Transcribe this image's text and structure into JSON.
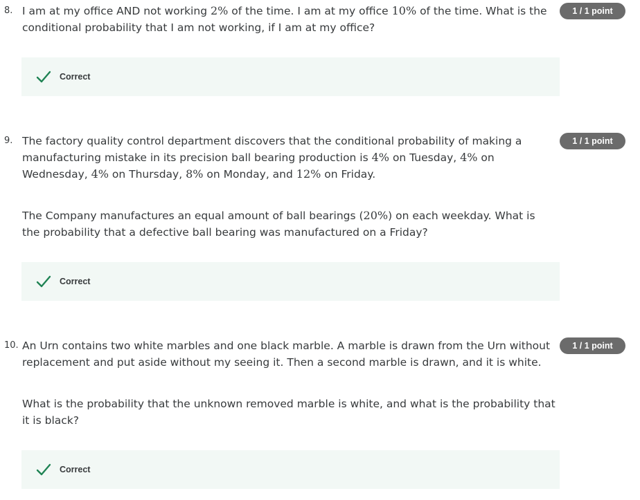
{
  "questions": [
    {
      "number": "8.",
      "points": "1 / 1 point",
      "status": "Correct",
      "paragraphs": [
        [
          {
            "t": "I am at my office AND not working "
          },
          {
            "t": "2%",
            "math": true
          },
          {
            "t": " of the time.  I am at my office "
          },
          {
            "t": "10%",
            "math": true
          },
          {
            "t": " of the time. What is the conditional probability that I am not working, if I am at my office?"
          }
        ]
      ]
    },
    {
      "number": "9.",
      "points": "1 / 1 point",
      "status": "Correct",
      "paragraphs": [
        [
          {
            "t": "The factory quality control department discovers that the conditional probability of making a manufacturing mistake in its precision ball bearing production is "
          },
          {
            "t": "4%",
            "math": true
          },
          {
            "t": " on Tuesday, "
          },
          {
            "t": "4%",
            "math": true
          },
          {
            "t": " on Wednesday, "
          },
          {
            "t": "4%",
            "math": true
          },
          {
            "t": " on Thursday, "
          },
          {
            "t": "8%",
            "math": true
          },
          {
            "t": " on Monday, and "
          },
          {
            "t": "12%",
            "math": true
          },
          {
            "t": " on Friday."
          }
        ],
        [
          {
            "t": "The Company manufactures an equal amount of ball bearings ("
          },
          {
            "t": "20%",
            "math": true
          },
          {
            "t": ") on each weekday.  What is the probability that a defective ball bearing was manufactured on a Friday?"
          }
        ]
      ]
    },
    {
      "number": "10.",
      "points": "1 / 1 point",
      "status": "Correct",
      "paragraphs": [
        [
          {
            "t": "An Urn contains two white marbles and one black marble. A marble is drawn from the Urn without replacement and put aside without my seeing it. Then a second marble is drawn, and it is white."
          }
        ],
        [
          {
            "t": "What is the probability that the unknown removed marble is white, and what is the probability that it is black?"
          }
        ]
      ]
    }
  ],
  "colors": {
    "badge_bg": "#6b6b6b",
    "correct_bg": "#f2f8f5",
    "check_green": "#1f8354",
    "text": "#373a3c"
  },
  "icons": {
    "correct": "check-icon"
  }
}
